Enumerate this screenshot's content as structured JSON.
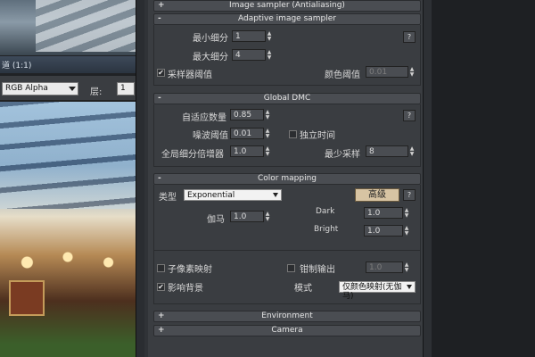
{
  "render_window": {
    "title": "道 (1:1)",
    "channel": "RGB Alpha",
    "layer_label": "层:",
    "layer_value": "1"
  },
  "image_sampler": {
    "title": "Image sampler (Antialiasing)",
    "sign": "+"
  },
  "adaptive": {
    "title": "Adaptive image sampler",
    "sign": "-",
    "min_subdiv_label": "最小细分",
    "min_subdiv_value": "1",
    "max_subdiv_label": "最大细分",
    "max_subdiv_value": "4",
    "threshold_check_label": "采样器阈值",
    "threshold_check": "✔",
    "color_threshold_label": "颜色阈值",
    "color_threshold_value": "0.01",
    "help": "?"
  },
  "global_dmc": {
    "title": "Global DMC",
    "sign": "-",
    "adaptive_amount_label": "自适应数量",
    "adaptive_amount_value": "0.85",
    "noise_threshold_label": "噪波阈值",
    "noise_threshold_value": "0.01",
    "independent_time_label": "独立时间",
    "global_subdiv_label": "全局细分倍增器",
    "global_subdiv_value": "1.0",
    "min_samples_label": "最少采样",
    "min_samples_value": "8",
    "help": "?"
  },
  "color_mapping": {
    "title": "Color mapping",
    "sign": "-",
    "type_label": "类型",
    "type_value": "Exponential",
    "advanced_button": "高级",
    "help": "?",
    "gamma_label": "伽马",
    "gamma_value": "1.0",
    "dark_label": "Dark",
    "dark_value": "1.0",
    "bright_label": "Bright",
    "bright_value": "1.0",
    "subpixel_label": "子像素映射",
    "clamp_label": "钳制输出",
    "clamp_value": "1.0",
    "affect_bg_label": "影响背景",
    "affect_bg_check": "✔",
    "mode_label": "模式",
    "mode_value": "仅颜色映射(无伽马)"
  },
  "environment": {
    "title": "Environment",
    "sign": "+"
  },
  "camera": {
    "title": "Camera",
    "sign": "+"
  }
}
